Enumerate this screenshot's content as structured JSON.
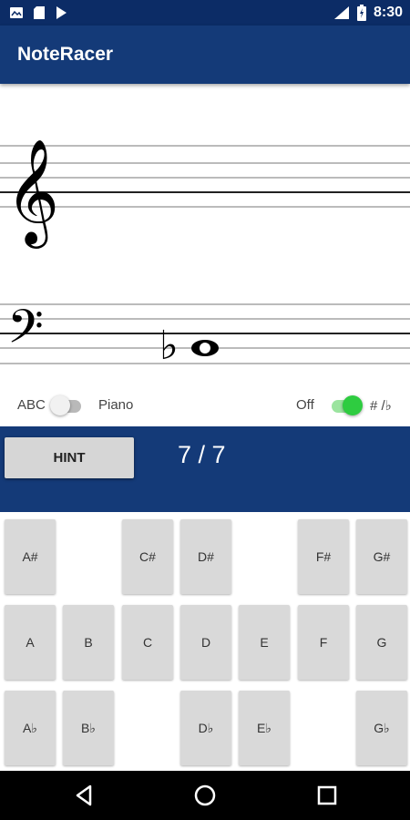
{
  "status_bar": {
    "time": "8:30",
    "network": "LTE"
  },
  "app": {
    "title": "NoteRacer"
  },
  "staff": {
    "note_accidental": "♭",
    "note": "whole-note",
    "treble_clef": "𝄞",
    "bass_clef": "𝄢"
  },
  "toggles": {
    "left": {
      "label_off": "ABC",
      "label_on": "Piano",
      "state": "off"
    },
    "right": {
      "label_off": "Off",
      "label_on": "# /♭",
      "state": "on"
    }
  },
  "hint": {
    "button_label": "HINT"
  },
  "score": {
    "text": "7 / 7"
  },
  "keys": {
    "sharps": [
      "A#",
      "C#",
      "D#",
      "F#",
      "G#"
    ],
    "naturals": [
      "A",
      "B",
      "C",
      "D",
      "E",
      "F",
      "G"
    ],
    "flats": [
      "A♭",
      "B♭",
      "D♭",
      "E♭",
      "G♭"
    ]
  },
  "colors": {
    "primary": "#143a78",
    "status": "#0c2c66",
    "accent_green": "#2ecc40",
    "key_gray": "#d9d9d9"
  }
}
